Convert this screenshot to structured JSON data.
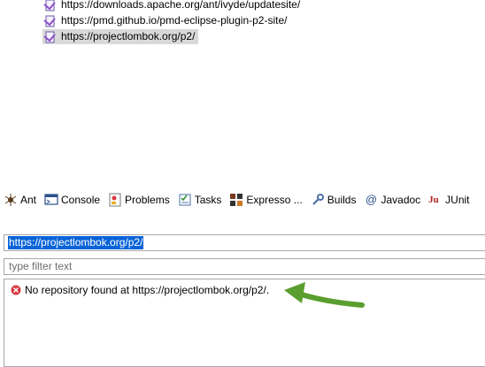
{
  "update_sites": [
    {
      "url": "https://downloads.apache.org/ant/ivyde/updatesite/",
      "selected": false
    },
    {
      "url": "https://pmd.github.io/pmd-eclipse-plugin-p2-site/",
      "selected": false
    },
    {
      "url": "https://projectlombok.org/p2/",
      "selected": true
    }
  ],
  "tabs": [
    {
      "label": "Ant",
      "icon": "ant-icon"
    },
    {
      "label": "Console",
      "icon": "console-icon"
    },
    {
      "label": "Problems",
      "icon": "problems-icon"
    },
    {
      "label": "Tasks",
      "icon": "tasks-icon"
    },
    {
      "label": "Expresso ...",
      "icon": "expresso-icon"
    },
    {
      "label": "Builds",
      "icon": "builds-icon"
    },
    {
      "label": "Javadoc",
      "icon": "javadoc-icon"
    },
    {
      "label": "JUnit",
      "icon": "junit-icon"
    }
  ],
  "repository_field": {
    "value": "https://projectlombok.org/p2/"
  },
  "filter_field": {
    "placeholder": "type filter text"
  },
  "results": {
    "message": "No repository found at https://projectlombok.org/p2/."
  },
  "colors": {
    "selection": "#0a64d8",
    "error": "#d9363e",
    "annotation_arrow": "#5a9e2f"
  }
}
